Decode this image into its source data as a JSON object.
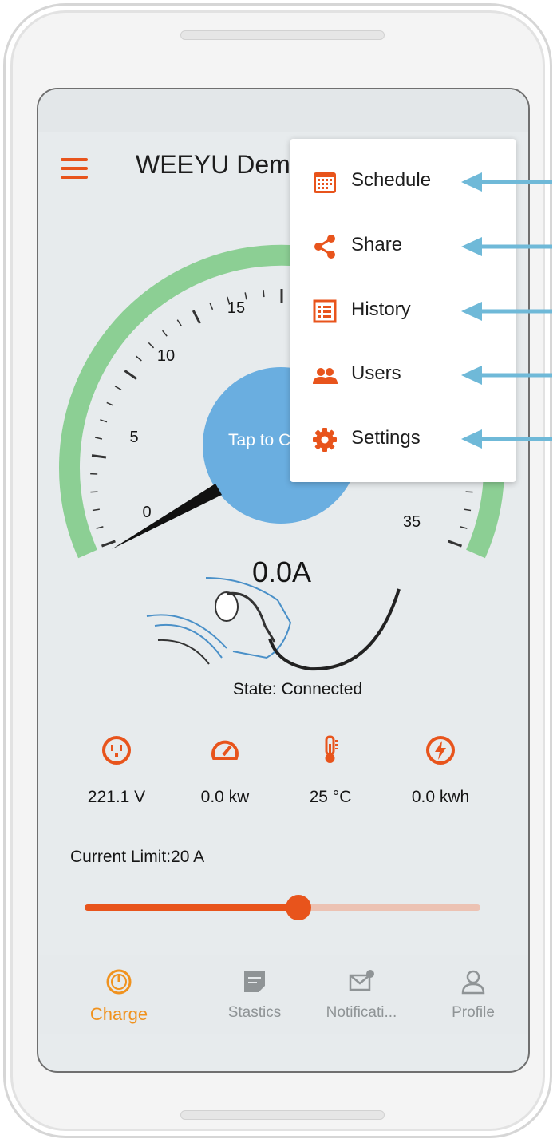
{
  "app_bar": {
    "title": "WEEYU Demo"
  },
  "gauge": {
    "tick_labels": [
      "0",
      "5",
      "10",
      "15",
      "35"
    ],
    "center_button": "Tap to Charge",
    "current_reading": "0.0A",
    "needle_value": 0
  },
  "state_text": "State: Connected",
  "stats": [
    {
      "icon": "outlet-icon",
      "value": "221.1 V"
    },
    {
      "icon": "speedometer-icon",
      "value": "0.0 kw"
    },
    {
      "icon": "thermometer-icon",
      "value": "25 °C"
    },
    {
      "icon": "lightning-icon",
      "value": "0.0 kwh"
    }
  ],
  "current_limit": {
    "label": "Current Limit:20 A",
    "value": 20,
    "fraction": 0.54
  },
  "menu": {
    "items": [
      {
        "icon": "calendar-icon",
        "label": "Schedule"
      },
      {
        "icon": "share-icon",
        "label": "Share"
      },
      {
        "icon": "list-icon",
        "label": "History"
      },
      {
        "icon": "users-icon",
        "label": "Users"
      },
      {
        "icon": "gear-icon",
        "label": "Settings"
      }
    ]
  },
  "bottom_nav": [
    {
      "icon": "gauge-icon",
      "label": "Charge",
      "active": true
    },
    {
      "icon": "notes-icon",
      "label": "Stastics",
      "active": false
    },
    {
      "icon": "mail-icon",
      "label": "Notificati...",
      "active": false
    },
    {
      "icon": "person-icon",
      "label": "Profile",
      "active": false
    }
  ],
  "colors": {
    "accent": "#e8541c",
    "nav_active": "#f0921e",
    "gauge_arc": "#8ccf94",
    "charge_button": "#6aaee0",
    "callout_arrow": "#6fb9d8"
  }
}
